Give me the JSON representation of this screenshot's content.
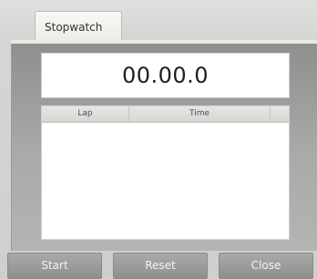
{
  "window": {
    "tab_title": "Stopwatch"
  },
  "timer": {
    "display": "00.00.0"
  },
  "lap_table": {
    "columns": [
      "Lap",
      "Time"
    ],
    "rows": []
  },
  "buttons": {
    "start": "Start",
    "reset": "Reset",
    "close": "Close"
  }
}
